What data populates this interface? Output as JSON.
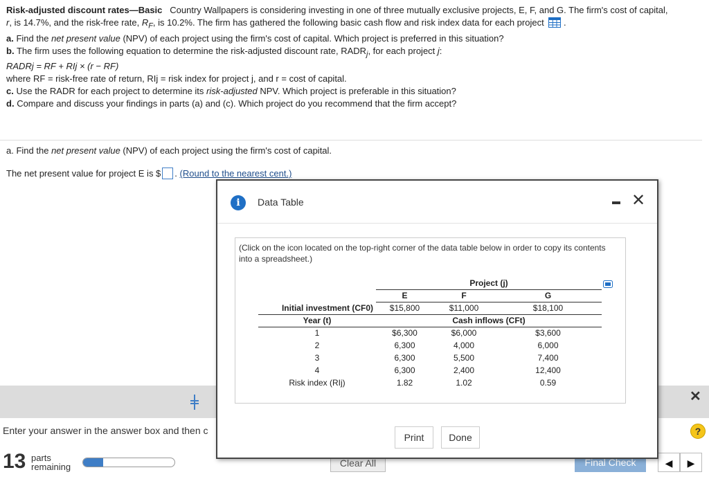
{
  "problem": {
    "title": "Risk-adjusted discount rates—Basic",
    "intro1": "Country Wallpapers is considering investing in one of three mutually exclusive projects, E, F, and G. The firm's cost of capital,",
    "intro2_r": "r",
    "intro2_a": ", is 14.7%, and the risk-free rate,",
    "intro2_rf": "R",
    "intro2_rf_sub": "F",
    "intro2_b": ", is 10.2%. The firm has gathered the following basic cash flow and risk index data for each project",
    "part_a_label": "a.",
    "part_a_1": "Find the",
    "part_a_npv": "net present value",
    "part_a_2": "(NPV) of each project using the firm's cost of capital. Which project is preferred in this situation?",
    "part_b_label": "b.",
    "part_b_text": "The firm uses the following equation to determine the risk-adjusted discount rate, RADR",
    "part_b_sub": "j",
    "part_b_end": ", for each project",
    "part_b_j": "j",
    "equation": "RADRj = RF + RIj × (r − RF)",
    "where_text": "where RF = risk-free rate of return, RIj = risk index for project j, and r = cost of capital.",
    "part_c_label": "c.",
    "part_c_1": "Use the RADR for each project to determine its",
    "part_c_ital": "risk-adjusted",
    "part_c_2": "NPV. Which project is preferable in this situation?",
    "part_d_label": "d.",
    "part_d_text": "Compare and discuss your findings in parts (a) and (c). Which project do you recommend that the firm accept?"
  },
  "question": {
    "part_a_repeat_1": "a. Find the",
    "part_a_repeat_ital": "net present value",
    "part_a_repeat_2": "(NPV) of each project using the firm's cost of capital.",
    "npv_prompt": "The net present value for project E is $",
    "round_note": "(Round to the nearest cent.)"
  },
  "dialog": {
    "title": "Data Table",
    "note": "(Click on the icon located on the top-right corner of the data table below in order to copy its contents into a spreadsheet.)",
    "print_label": "Print",
    "done_label": "Done"
  },
  "data_table": {
    "project_header": "Project (j)",
    "projects": [
      "E",
      "F",
      "G"
    ],
    "initial_label": "Initial investment (CF0)",
    "initial": [
      "$15,800",
      "$11,000",
      "$18,100"
    ],
    "year_label": "Year (t)",
    "cash_label": "Cash inflows (CFt)",
    "rows": [
      {
        "year": "1",
        "e": "$6,300",
        "f": "$6,000",
        "g": "$3,600"
      },
      {
        "year": "2",
        "e": "6,300",
        "f": "4,000",
        "g": "6,000"
      },
      {
        "year": "3",
        "e": "6,300",
        "f": "5,500",
        "g": "7,400"
      },
      {
        "year": "4",
        "e": "6,300",
        "f": "2,400",
        "g": "12,400"
      }
    ],
    "risk_label": "Risk index (RIj)",
    "risk": [
      "1.82",
      "1.02",
      "0.59"
    ]
  },
  "footer": {
    "enter_msg": "Enter your answer in the answer box and then c",
    "parts_count": "13",
    "parts_word": "parts",
    "remaining_word": "remaining",
    "progress": 0.22,
    "clear_all": "Clear All",
    "final_check": "Final Check",
    "help": "?"
  }
}
